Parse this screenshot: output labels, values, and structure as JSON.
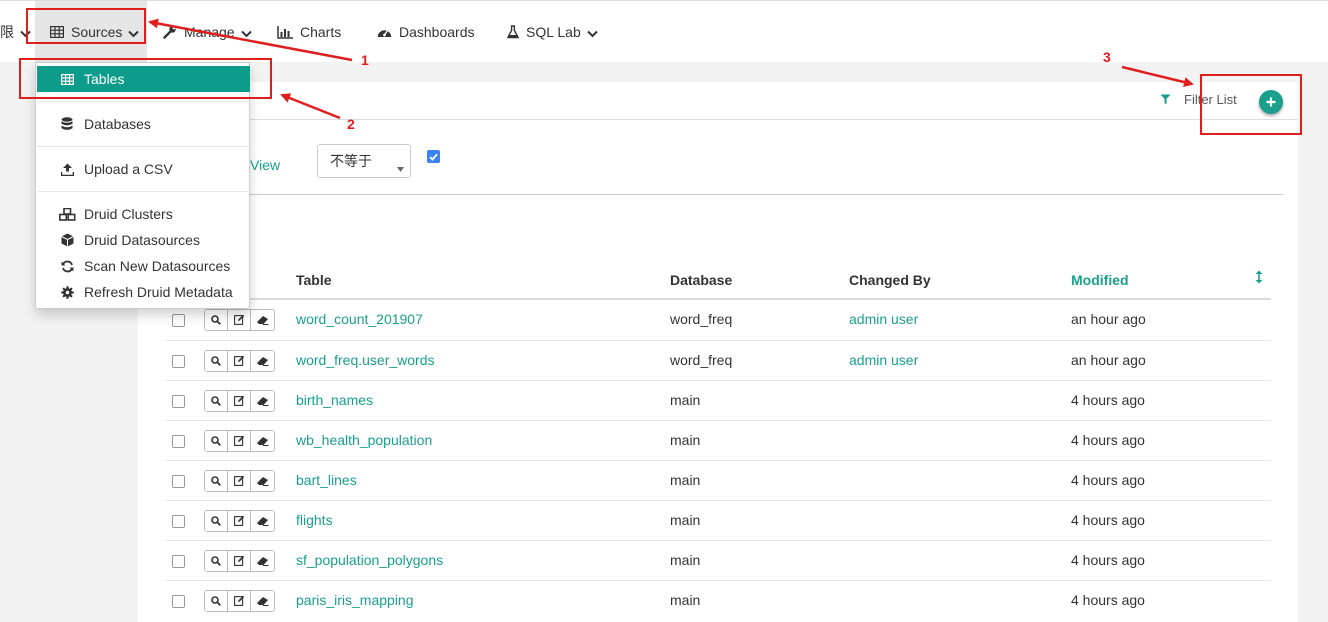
{
  "navbar": {
    "partial_item_label": "限",
    "items": [
      {
        "label": "Sources",
        "icon": "table-icon",
        "has_dropdown": true,
        "active": true
      },
      {
        "label": "Manage",
        "icon": "wrench-icon",
        "has_dropdown": true
      },
      {
        "label": "Charts",
        "icon": "bar-chart-icon",
        "has_dropdown": false
      },
      {
        "label": "Dashboards",
        "icon": "dashboard-icon",
        "has_dropdown": false
      },
      {
        "label": "SQL Lab",
        "icon": "flask-icon",
        "has_dropdown": true
      }
    ]
  },
  "sources_menu": {
    "items": [
      {
        "label": "Tables",
        "icon": "table-icon",
        "active": true
      },
      {
        "label": "Databases",
        "icon": "database-icon"
      },
      {
        "label": "Upload a CSV",
        "icon": "upload-icon"
      },
      {
        "label": "Druid Clusters",
        "icon": "cubes-icon"
      },
      {
        "label": "Druid Datasources",
        "icon": "cube-icon"
      },
      {
        "label": "Scan New Datasources",
        "icon": "refresh-icon"
      },
      {
        "label": "Refresh Druid Metadata",
        "icon": "cog-icon"
      }
    ]
  },
  "panel": {
    "filter_list_label": "Filter List",
    "add_button_label": "+",
    "filter_row": {
      "view_link": "View",
      "operator_value": "不等于",
      "checkbox_checked": true
    }
  },
  "table": {
    "columns": [
      "Table",
      "Database",
      "Changed By",
      "Modified"
    ],
    "sorted_column": "Modified",
    "rows": [
      {
        "table": "word_count_201907",
        "database": "word_freq",
        "changed_by": "admin user",
        "modified": "an hour ago"
      },
      {
        "table": "word_freq.user_words",
        "database": "word_freq",
        "changed_by": "admin user",
        "modified": "an hour ago"
      },
      {
        "table": "birth_names",
        "database": "main",
        "changed_by": "",
        "modified": "4 hours ago"
      },
      {
        "table": "wb_health_population",
        "database": "main",
        "changed_by": "",
        "modified": "4 hours ago"
      },
      {
        "table": "bart_lines",
        "database": "main",
        "changed_by": "",
        "modified": "4 hours ago"
      },
      {
        "table": "flights",
        "database": "main",
        "changed_by": "",
        "modified": "4 hours ago"
      },
      {
        "table": "sf_population_polygons",
        "database": "main",
        "changed_by": "",
        "modified": "4 hours ago"
      },
      {
        "table": "paris_iris_mapping",
        "database": "main",
        "changed_by": "",
        "modified": "4 hours ago"
      }
    ]
  },
  "annotations": {
    "labels": [
      "1",
      "2",
      "3"
    ],
    "color": "#e01e1e"
  },
  "colors": {
    "accent": "#1a9f8b",
    "menu_active": "#0d9c8a",
    "checkbox_blue": "#3b82f6"
  }
}
